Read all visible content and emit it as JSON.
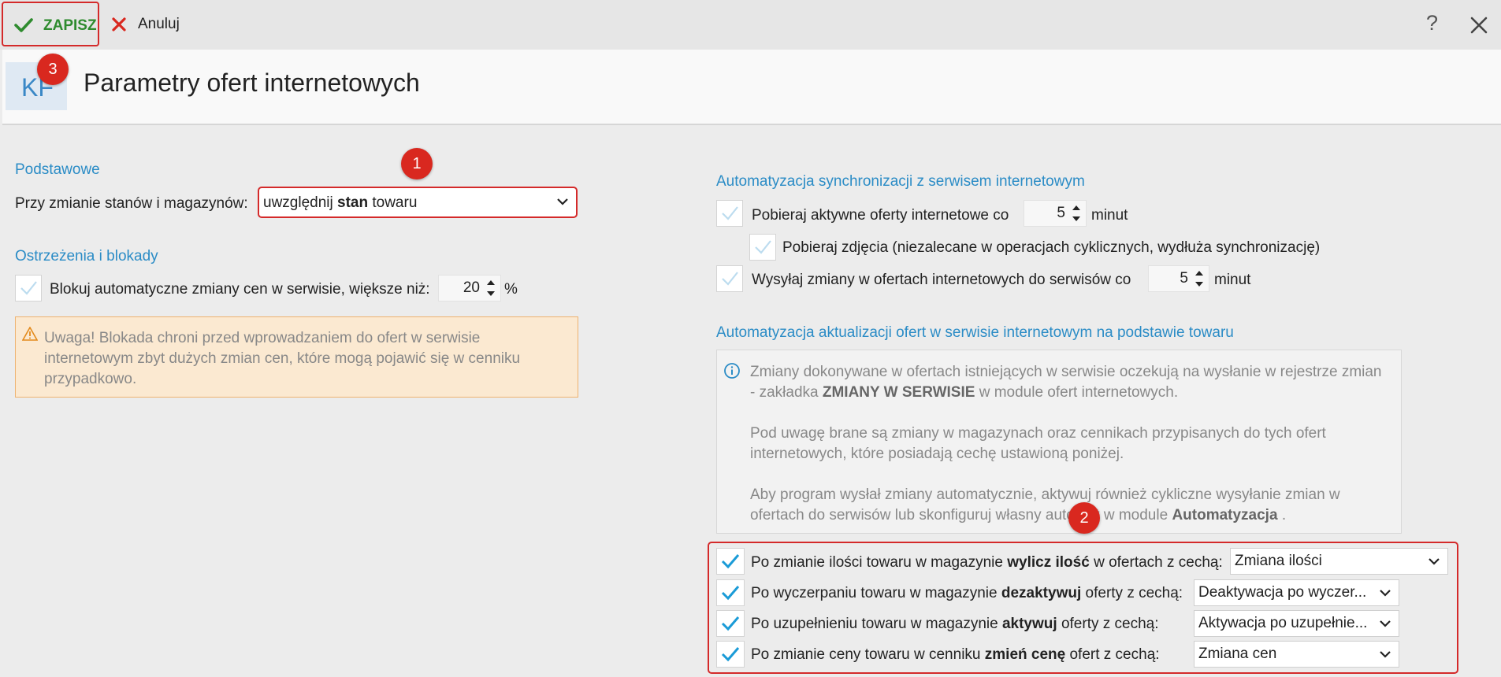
{
  "toolbar": {
    "save_label": "ZAPISZ",
    "cancel_label": "Anuluj",
    "help_label": "?"
  },
  "header": {
    "logo_text": "KF",
    "title": "Parametry ofert internetowych"
  },
  "badges": [
    "1",
    "2",
    "3"
  ],
  "basic": {
    "section_title": "Podstawowe",
    "stock_label": "Przy zmianie stanów i magazynów:",
    "stock_value_pre": "uwzględnij ",
    "stock_value_bold": "stan",
    "stock_value_post": " towaru"
  },
  "warnings": {
    "section_title": "Ostrzeżenia i blokady",
    "block_label": "Blokuj automatyczne zmiany cen w serwisie, większe niż:",
    "block_value": "20",
    "block_unit": "%",
    "block_checked": true,
    "notice": "Uwaga! Blokada chroni przed wprowadzaniem do ofert w serwisie internetowym zbyt dużych zmian cen, które mogą pojawić się w cenniku przypadkowo."
  },
  "sync": {
    "section_title": "Automatyzacja synchronizacji z serwisem internetowym",
    "fetch_label": "Pobieraj aktywne oferty internetowe co",
    "fetch_value": "5",
    "fetch_unit": "minut",
    "photos_label": "Pobieraj zdjęcia (niezalecane w operacjach cyklicznych, wydłuża synchronizację)",
    "send_label": "Wysyłaj zmiany w ofertach internetowych do serwisów co",
    "send_value": "5",
    "send_unit": "minut"
  },
  "update": {
    "section_title": "Automatyzacja aktualizacji ofert w serwisie internetowym na podstawie towaru",
    "info_p1_a": "Zmiany dokonywane w ofertach istniejących w serwisie oczekują na wysłanie w rejestrze zmian - zakładka ",
    "info_p1_bold": "ZMIANY W SERWISIE",
    "info_p1_b": " w module ofert internetowych.",
    "info_p2": "Pod uwagę brane są zmiany w magazynach oraz cennikach przypisanych do tych ofert internetowych, które posiadają cechę ustawioną poniżej.",
    "info_p3_a": "Aby program wysłał zmiany automatycznie, aktywuj również cykliczne wysyłanie zmian w ofertach do serwisów lub skonfiguruj własny automat w module ",
    "info_p3_bold": "Automatyzacja",
    "info_p3_b": " .",
    "rules": [
      {
        "pre": "Po zmianie ilości towaru w magazynie ",
        "bold": "wylicz ilość",
        "post": " w ofertach z cechą:",
        "value": "Zmiana ilości",
        "checked": true
      },
      {
        "pre": "Po wyczerpaniu towaru w magazynie ",
        "bold": "dezaktywuj",
        "post": " oferty z cechą:",
        "value": "Deaktywacja po wyczer...",
        "checked": true
      },
      {
        "pre": "Po uzupełnieniu towaru w magazynie ",
        "bold": "aktywuj",
        "post": " oferty z cechą:",
        "value": "Aktywacja po uzupełnie...",
        "checked": true
      },
      {
        "pre": "Po zmianie ceny towaru w cenniku ",
        "bold": "zmień cenę",
        "post": " ofert z cechą:",
        "value": "Zmiana cen",
        "checked": true
      }
    ]
  },
  "colors": {
    "accent": "#2b8cc6",
    "highlight": "#d42a2a",
    "save_green": "#2e8b2e",
    "warning_bg": "#fbe9d1",
    "check_blue": "#1a9bd7"
  }
}
